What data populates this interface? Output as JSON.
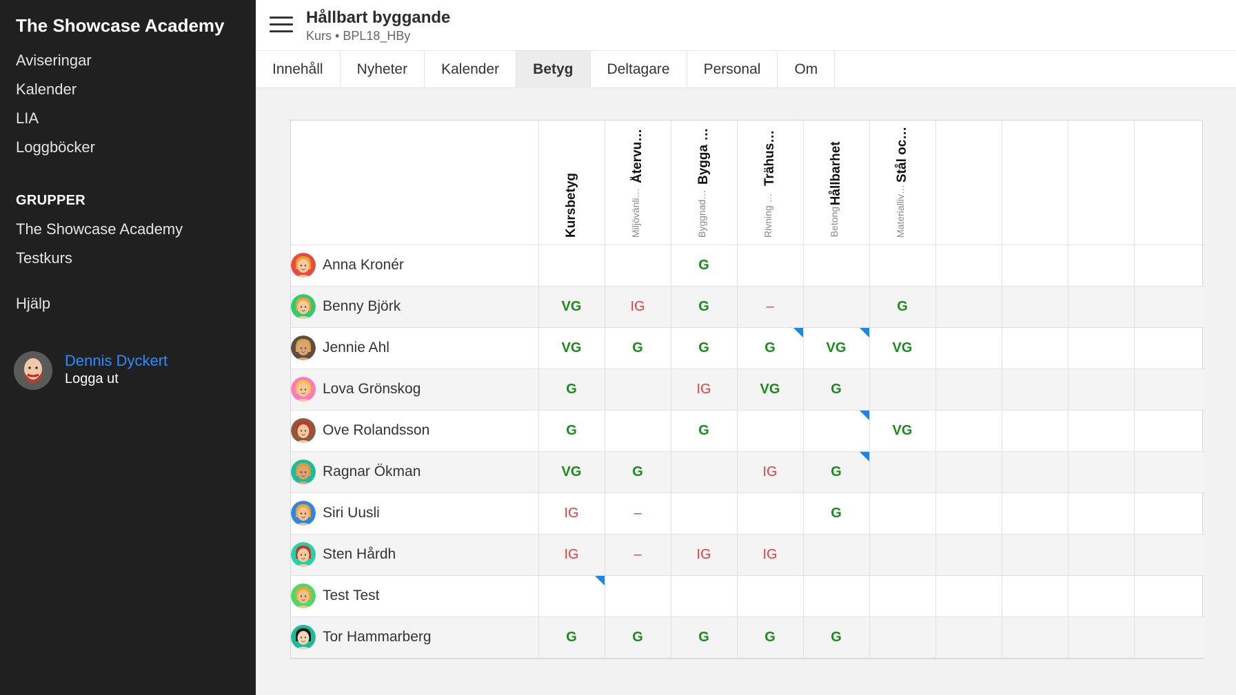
{
  "sidebar": {
    "brand": "The Showcase Academy",
    "nav": [
      "Aviseringar",
      "Kalender",
      "LIA",
      "Loggböcker"
    ],
    "groups_heading": "GRUPPER",
    "groups": [
      "The Showcase Academy",
      "Testkurs"
    ],
    "help": "Hjälp",
    "user": {
      "name": "Dennis Dyckert",
      "logout": "Logga ut"
    }
  },
  "header": {
    "title": "Hållbart byggande",
    "subtitle": "Kurs  •  BPL18_HBy"
  },
  "tabs": [
    {
      "label": "Innehåll",
      "active": false
    },
    {
      "label": "Nyheter",
      "active": false
    },
    {
      "label": "Kalender",
      "active": false
    },
    {
      "label": "Betyg",
      "active": true
    },
    {
      "label": "Deltagare",
      "active": false
    },
    {
      "label": "Personal",
      "active": false
    },
    {
      "label": "Om",
      "active": false
    }
  ],
  "columns": [
    {
      "small": "",
      "big": "Kursbetyg"
    },
    {
      "small": "Miljövänliga mate...",
      "big": "Återvunnet tr..."
    },
    {
      "small": "Byggnaders livscy...",
      "big": "Bygga för att r..."
    },
    {
      "small": "Rivning miljövänli...",
      "big": "Trähusdestruk..."
    },
    {
      "small": "Betong",
      "big": "Hållbarhet"
    },
    {
      "small": "Materiallivslängd",
      "big": "Stål och järn"
    },
    {
      "small": "",
      "big": ""
    },
    {
      "small": "",
      "big": ""
    },
    {
      "small": "",
      "big": ""
    },
    {
      "small": "",
      "big": ""
    }
  ],
  "students": [
    {
      "name": "Anna Kronér",
      "avatar": {
        "bg": "#e74c3c",
        "hair": "#f0a030",
        "skin": "#f5c9a0"
      },
      "grades": [
        "",
        "",
        "G",
        "",
        "",
        "",
        "",
        "",
        "",
        ""
      ],
      "flags": []
    },
    {
      "name": "Benny Björk",
      "avatar": {
        "bg": "#2ecc71",
        "hair": "#f0a030",
        "skin": "#f5c9a0"
      },
      "grades": [
        "VG",
        "IG",
        "G",
        "–",
        "",
        "G",
        "",
        "",
        "",
        ""
      ],
      "flags": []
    },
    {
      "name": "Jennie Ahl",
      "avatar": {
        "bg": "#5d4e41",
        "hair": "#d9a441",
        "skin": "#d8a57a"
      },
      "grades": [
        "VG",
        "G",
        "G",
        "G",
        "VG",
        "VG",
        "",
        "",
        "",
        ""
      ],
      "flags": [
        3,
        4
      ]
    },
    {
      "name": "Lova Grönskog",
      "avatar": {
        "bg": "#ff7ab8",
        "hair": "#f5c542",
        "skin": "#f5c9a0"
      },
      "grades": [
        "G",
        "",
        "IG",
        "VG",
        "G",
        "",
        "",
        "",
        "",
        ""
      ],
      "flags": []
    },
    {
      "name": "Ove Rolandsson",
      "avatar": {
        "bg": "#8e5a3c",
        "hair": "#c0392b",
        "skin": "#f5c9a0"
      },
      "grades": [
        "G",
        "",
        "G",
        "",
        "",
        "VG",
        "",
        "",
        "",
        ""
      ],
      "flags": [
        4
      ]
    },
    {
      "name": "Ragnar Ökman",
      "avatar": {
        "bg": "#1abc9c",
        "hair": "#d0a040",
        "skin": "#e0a070"
      },
      "grades": [
        "VG",
        "G",
        "",
        "IG",
        "G",
        "",
        "",
        "",
        "",
        ""
      ],
      "flags": [
        4
      ]
    },
    {
      "name": "Siri Uusli",
      "avatar": {
        "bg": "#2e86de",
        "hair": "#e8a530",
        "skin": "#f0c090"
      },
      "grades": [
        "IG",
        "–",
        "",
        "",
        "G",
        "",
        "",
        "",
        "",
        ""
      ],
      "flags": []
    },
    {
      "name": "Sten Hårdh",
      "avatar": {
        "bg": "#26d0a8",
        "hair": "#c0392b",
        "skin": "#f5c9a0"
      },
      "grades": [
        "IG",
        "–",
        "IG",
        "IG",
        "",
        "",
        "",
        "",
        "",
        ""
      ],
      "flags": []
    },
    {
      "name": "Test Test",
      "avatar": {
        "bg": "#4cd964",
        "hair": "#e8a530",
        "skin": "#f0c090"
      },
      "grades": [
        "",
        "",
        "",
        "",
        "",
        "",
        "",
        "",
        "",
        ""
      ],
      "flags": [
        0
      ]
    },
    {
      "name": "Tor Hammarberg",
      "avatar": {
        "bg": "#1abc9c",
        "hair": "#111111",
        "skin": "#f5d5b8"
      },
      "grades": [
        "G",
        "G",
        "G",
        "G",
        "G",
        "",
        "",
        "",
        "",
        ""
      ],
      "flags": []
    }
  ],
  "colors": {
    "pass": "#1b8a1b",
    "fail": "#e23b3b",
    "flag": "#1f86e0",
    "link": "#2d8cff"
  }
}
